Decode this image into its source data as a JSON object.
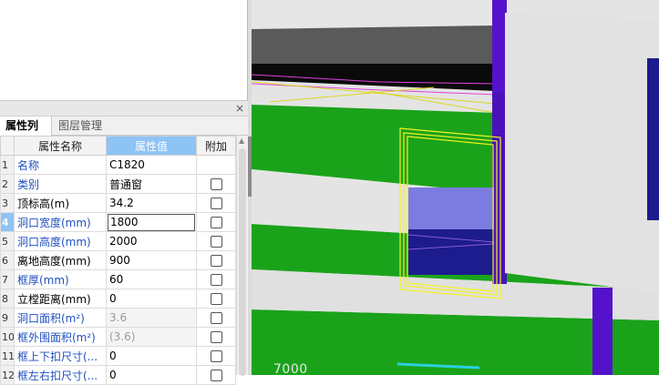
{
  "panel": {
    "close_symbol": "×",
    "tabs": [
      {
        "label": "属性列表",
        "active": true
      },
      {
        "label": "图层管理",
        "active": false
      }
    ],
    "columns": {
      "number": "",
      "name": "属性名称",
      "value": "属性值",
      "extra": "附加"
    }
  },
  "properties": [
    {
      "num": "1",
      "name": "名称",
      "value": "C1820",
      "name_style": "blue",
      "value_style": "normal",
      "checkbox": false
    },
    {
      "num": "2",
      "name": "类别",
      "value": "普通窗",
      "name_style": "blue",
      "value_style": "normal",
      "checkbox": true
    },
    {
      "num": "3",
      "name": "顶标高(m)",
      "value": "34.2",
      "name_style": "black",
      "value_style": "normal",
      "checkbox": true
    },
    {
      "num": "4",
      "name": "洞口宽度(mm)",
      "value": "1800",
      "name_style": "blue",
      "value_style": "editing",
      "checkbox": true
    },
    {
      "num": "5",
      "name": "洞口高度(mm)",
      "value": "2000",
      "name_style": "blue",
      "value_style": "normal",
      "checkbox": true
    },
    {
      "num": "6",
      "name": "离地高度(mm)",
      "value": "900",
      "name_style": "black",
      "value_style": "normal",
      "checkbox": true
    },
    {
      "num": "7",
      "name": "框厚(mm)",
      "value": "60",
      "name_style": "blue",
      "value_style": "normal",
      "checkbox": true
    },
    {
      "num": "8",
      "name": "立樘距离(mm)",
      "value": "0",
      "name_style": "black",
      "value_style": "normal",
      "checkbox": true
    },
    {
      "num": "9",
      "name": "洞口面积(m²)",
      "value": "3.6",
      "name_style": "blue",
      "value_style": "disabled",
      "checkbox": true
    },
    {
      "num": "10",
      "name": "框外围面积(m²)",
      "value": "(3.6)",
      "name_style": "blue",
      "value_style": "disabled",
      "checkbox": true
    },
    {
      "num": "11",
      "name": "框上下扣尺寸(...",
      "value": "0",
      "name_style": "blue",
      "value_style": "normal",
      "checkbox": true
    },
    {
      "num": "12",
      "name": "框左右扣尺寸(...",
      "value": "0",
      "name_style": "blue",
      "value_style": "normal",
      "checkbox": true
    }
  ],
  "selected_row": "4",
  "viewport": {
    "dimension_label": "7000",
    "colors": {
      "wall_gray": "#e4e4e4",
      "slab_green": "#1aa31a",
      "column_purple": "#5512cc",
      "window_frame": "#f5f21e",
      "glass_light": "#7c7ce0",
      "glass_dark": "#1c1c8e",
      "dark_band": "#5a5a5a",
      "black_band": "#0a0a0a",
      "magenta_line": "#e040e0",
      "cyan_line": "#2ad0e0"
    }
  },
  "accent": "#8ec3f5"
}
